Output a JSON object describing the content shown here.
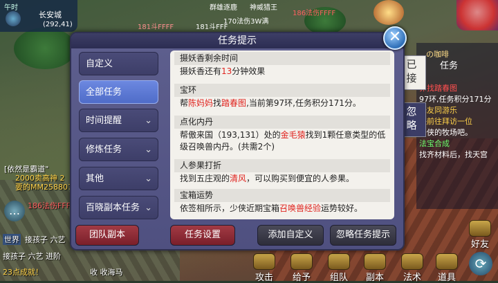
{
  "dialog": {
    "title": "任务提示",
    "close_symbol": "✕"
  },
  "categories": [
    {
      "label": "自定义",
      "active": false,
      "chevron": ""
    },
    {
      "label": "全部任务",
      "active": true,
      "chevron": ""
    },
    {
      "label": "时间提醒",
      "active": false,
      "chevron": "⌄"
    },
    {
      "label": "修炼任务",
      "active": false,
      "chevron": "⌄"
    },
    {
      "label": "其他",
      "active": false,
      "chevron": "⌄"
    },
    {
      "label": "百晓副本任务",
      "active": false,
      "chevron": "⌄"
    }
  ],
  "tasks": [
    {
      "title": "摄妖香剩余时间",
      "parts": [
        {
          "t": "摄妖香还有",
          "red": false
        },
        {
          "t": "13",
          "red": true
        },
        {
          "t": "分钟效果",
          "red": false
        }
      ]
    },
    {
      "title": "宝环",
      "parts": [
        {
          "t": "帮",
          "red": false
        },
        {
          "t": "陈妈妈",
          "red": true
        },
        {
          "t": "找",
          "red": false
        },
        {
          "t": "踏春图",
          "red": true
        },
        {
          "t": ",当前第97环,任务积分171分。",
          "red": false
        }
      ]
    },
    {
      "title": "点化内丹",
      "parts": [
        {
          "t": "帮傲来国（193,131）处的",
          "red": false
        },
        {
          "t": "金毛猿",
          "red": true
        },
        {
          "t": "找到1颗任意类型的低级召唤兽内丹。(共需2个)",
          "red": false
        }
      ]
    },
    {
      "title": "人参果打折",
      "parts": [
        {
          "t": "找到五庄观的",
          "red": false
        },
        {
          "t": "清风",
          "red": true
        },
        {
          "t": "，可以购买到便宜的人参果。",
          "red": false
        }
      ]
    },
    {
      "title": "宝箱运势",
      "parts": [
        {
          "t": "依签相所示，少侠近期宝箱",
          "red": false
        },
        {
          "t": "召唤兽经验",
          "red": true
        },
        {
          "t": "运势较好。",
          "red": false
        }
      ]
    }
  ],
  "buttons": {
    "team_dungeon": "团队副本",
    "task_settings": "任务设置",
    "add_custom": "添加自定义",
    "ignore_tips": "忽略任务提示"
  },
  "side_tabs": {
    "accepted": "已接",
    "ignored": "忽略"
  },
  "side_panel": {
    "header": "任务",
    "lines": [
      {
        "t": "卯找踏春图",
        "color": "#ff5050"
      },
      {
        "t": "97环,任务积分171分",
        "color": "#ffffff"
      },
      {
        "t": "驿友同游乐",
        "color": "#ffd24a"
      },
      {
        "t": "快前往拜访一位",
        "color": "#ffd24a"
      },
      {
        "t": "少侠的牧场吧。",
        "color": "#ffffff"
      },
      {
        "t": "法宝合成",
        "color": "#6cff6c"
      },
      {
        "t": "找齐材料后，找天宫",
        "color": "#ffffff"
      }
    ],
    "caption": "の咖啡"
  },
  "hud": {
    "time_label": "午时",
    "map_name": "长安城",
    "coords": "(292,41)",
    "top_chips": [
      "群雄逐鹿",
      "神威猎王",
      "186法伤FFFF",
      "181斗FFFF",
      "181斗FFF",
      "170法伤3W满"
    ]
  },
  "chat": [
    {
      "t": "[依然是霸道\"",
      "color": "#ffffff"
    },
    {
      "t": "2000卖高神 2",
      "color": "#ffd24a"
    },
    {
      "t": "要的MM258807",
      "color": "#ffd24a"
    },
    {
      "t": "186法伤FFFF",
      "color": "#ff6060"
    },
    {
      "t": "世界",
      "color": "#ffffff"
    },
    {
      "t": "接孩子 六艺",
      "color": "#ffffff"
    },
    {
      "t": "接孩子 六艺 进阶",
      "color": "#ffffff"
    },
    {
      "t": "23点成就！",
      "color": "#ffd24a"
    },
    {
      "t": "收 收海马",
      "color": "#ffffff"
    }
  ],
  "bottom_bar": [
    "攻击",
    "给予",
    "组队",
    "副本",
    "法术",
    "道具",
    "好友"
  ]
}
